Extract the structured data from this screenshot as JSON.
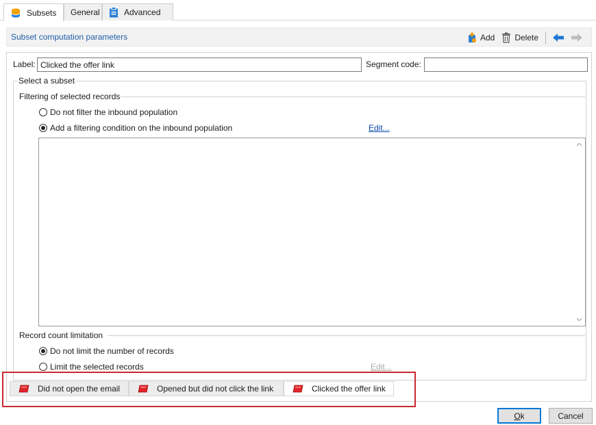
{
  "tabs": [
    {
      "label": "Subsets",
      "icon": "database-icon",
      "active": true
    },
    {
      "label": "General",
      "icon": "",
      "active": false
    },
    {
      "label": "Advanced",
      "icon": "clipboard-icon",
      "active": false
    }
  ],
  "section": {
    "title": "Subset computation parameters",
    "add_label": "Add",
    "delete_label": "Delete"
  },
  "form": {
    "label_caption": "Label:",
    "label_value": "Clicked the offer link",
    "segment_caption": "Segment code:",
    "segment_value": ""
  },
  "select_subset": {
    "title": "Select a subset",
    "filtering": {
      "title": "Filtering of selected records",
      "option_none": "Do not filter the inbound population",
      "option_condition": "Add a filtering condition on the inbound population",
      "selected": "option_condition",
      "edit_link": "Edit..."
    },
    "limitation": {
      "title": "Record count limitation",
      "option_none": "Do not limit the number of records",
      "option_limit": "Limit the selected records",
      "selected": "option_none",
      "edit_link": "Edit..."
    }
  },
  "subset_tabs": [
    {
      "label": "Did not open the email",
      "active": false
    },
    {
      "label": "Opened but did not click the link",
      "active": false
    },
    {
      "label": "Clicked the offer link",
      "active": true
    }
  ],
  "buttons": {
    "ok": "Ok",
    "cancel": "Cancel"
  },
  "colors": {
    "accent": "#1f5fa8",
    "highlight": "#c8282e",
    "arrow_active": "#1e78d4",
    "arrow_inactive": "#bcbcbc"
  }
}
